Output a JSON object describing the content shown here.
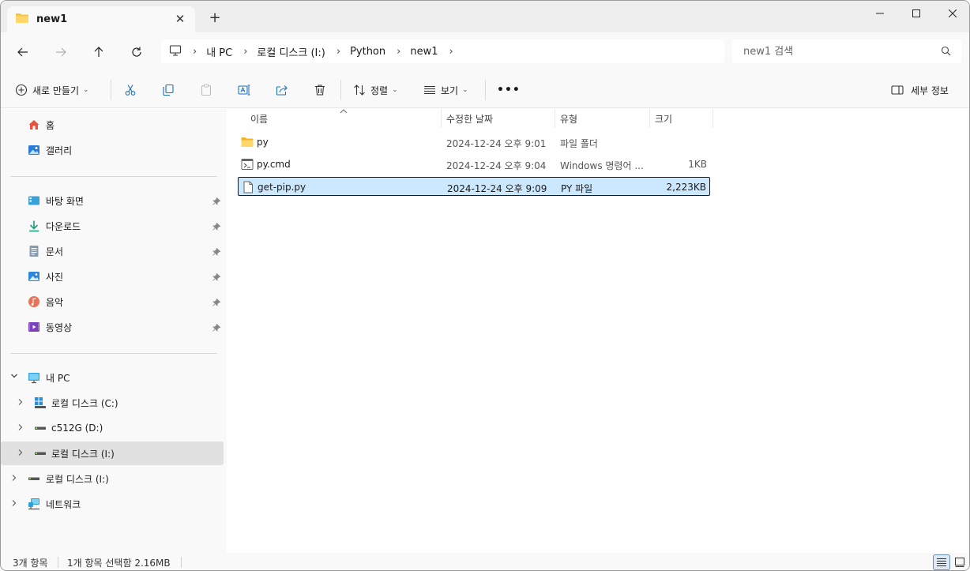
{
  "tab": {
    "title": "new1",
    "close_glyph": "✕",
    "new_tab_glyph": "+"
  },
  "breadcrumb": [
    {
      "label": "내 PC"
    },
    {
      "label": "로컬 디스크 (I:)"
    },
    {
      "label": "Python"
    },
    {
      "label": "new1"
    }
  ],
  "search": {
    "placeholder": "new1 검색"
  },
  "toolbar": {
    "new_label": "새로 만들기",
    "sort_label": "정렬",
    "view_label": "보기",
    "more_label": "•••",
    "details_label": "세부 정보"
  },
  "sidebar": {
    "quick": [
      {
        "label": "홈",
        "icon": "home-icon"
      },
      {
        "label": "갤러리",
        "icon": "gallery-icon"
      }
    ],
    "pinned": [
      {
        "label": "바탕 화면",
        "icon": "desktop-icon"
      },
      {
        "label": "다운로드",
        "icon": "download-icon"
      },
      {
        "label": "문서",
        "icon": "document-icon"
      },
      {
        "label": "사진",
        "icon": "pictures-icon"
      },
      {
        "label": "음악",
        "icon": "music-icon"
      },
      {
        "label": "동영상",
        "icon": "video-icon"
      }
    ],
    "this_pc": "내 PC",
    "drives": [
      {
        "label": "로컬 디스크 (C:)",
        "icon": "windows-drive-icon"
      },
      {
        "label": "c512G (D:)",
        "icon": "drive-icon"
      },
      {
        "label": "로컬 디스크 (I:)",
        "icon": "drive-icon"
      }
    ],
    "external_drive": "로컬 디스크 (I:)",
    "network": "네트워크"
  },
  "columns": {
    "name": "이름",
    "date": "수정한 날짜",
    "type": "유형",
    "size": "크기"
  },
  "files": [
    {
      "name": "py",
      "date": "2024-12-24 오후 9:01",
      "type": "파일 폴더",
      "size": "",
      "icon": "folder-icon",
      "selected": false
    },
    {
      "name": "py.cmd",
      "date": "2024-12-24 오후 9:04",
      "type": "Windows 명령어 ...",
      "size": "1KB",
      "icon": "cmd-file-icon",
      "selected": false
    },
    {
      "name": "get-pip.py",
      "date": "2024-12-24 오후 9:09",
      "type": "PY 파일",
      "size": "2,223KB",
      "icon": "file-icon",
      "selected": true
    }
  ],
  "status": {
    "count": "3개 항목",
    "selection": "1개 항목 선택함 2.16MB"
  },
  "colors": {
    "accent": "#0067c0",
    "selection": "#cce8ff",
    "folder": "#f8c548"
  }
}
